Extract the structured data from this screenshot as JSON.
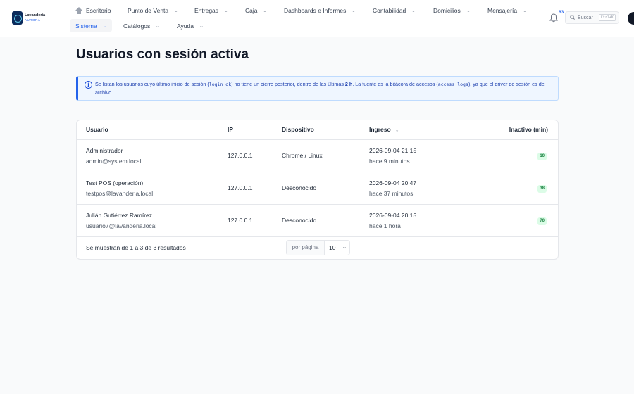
{
  "logo": {
    "line1": "Lavandería",
    "line2": "AURORA"
  },
  "nav": {
    "row1": [
      {
        "label": "Escritorio"
      },
      {
        "label": "Punto de Venta"
      },
      {
        "label": "Entregas"
      },
      {
        "label": "Caja"
      },
      {
        "label": "Dashboards e Informes"
      },
      {
        "label": "Contabilidad"
      },
      {
        "label": "Domicilios"
      },
      {
        "label": "Mensajería"
      }
    ],
    "row2": [
      {
        "label": "Sistema"
      },
      {
        "label": "Catálogos"
      },
      {
        "label": "Ayuda"
      }
    ]
  },
  "notifications": {
    "count": "63"
  },
  "search": {
    "label": "Buscar",
    "shortcut": "Ctrl+K"
  },
  "page": {
    "title": "Usuarios con sesión activa"
  },
  "info": {
    "p1": "Se listan los usuarios cuyo último inicio de sesión (",
    "code1": "login_ok",
    "p2": ") no tiene un cierre posterior, dentro de las últimas ",
    "bold": "2 h",
    "p3": ". La fuente es la bitácora de accesos (",
    "code2": "access_logs",
    "p4": "), ya que el driver de sesión es de archivo."
  },
  "table": {
    "headers": {
      "user": "Usuario",
      "ip": "IP",
      "device": "Dispositivo",
      "login": "Ingreso",
      "idle": "Inactivo (min)"
    },
    "rows": [
      {
        "name": "Administrador",
        "email": "admin@system.local",
        "ip": "127.0.0.1",
        "device": "Chrome / Linux",
        "login": "2026-09-04 21:15",
        "ago": "hace 9 minutos",
        "idle": "10"
      },
      {
        "name": "Test POS (operación)",
        "email": "testpos@lavanderia.local",
        "ip": "127.0.0.1",
        "device": "Desconocido",
        "login": "2026-09-04 20:47",
        "ago": "hace 37 minutos",
        "idle": "38"
      },
      {
        "name": "Julián Gutiérrez Ramírez",
        "email": "usuario7@lavanderia.local",
        "ip": "127.0.0.1",
        "device": "Desconocido",
        "login": "2026-09-04 20:15",
        "ago": "hace 1 hora",
        "idle": "70"
      }
    ],
    "footer": "Se muestran de 1 a 3 de 3 resultados",
    "per_page_label": "por página",
    "per_page_value": "10"
  }
}
